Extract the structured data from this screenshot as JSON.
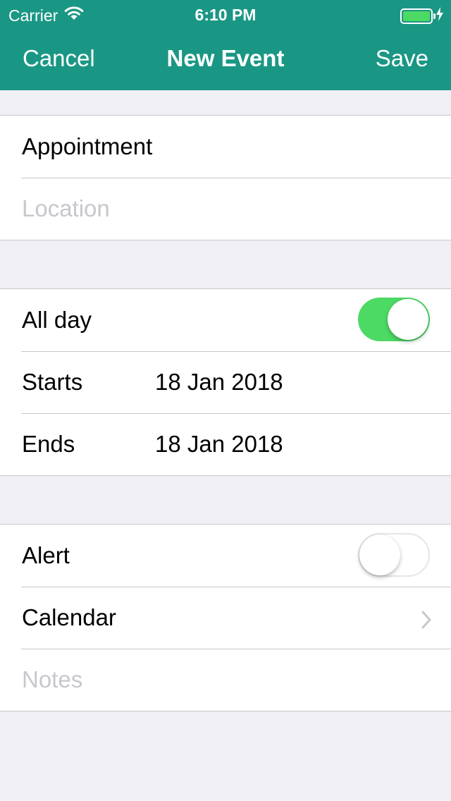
{
  "status_bar": {
    "carrier": "Carrier",
    "time": "6:10 PM",
    "battery_level": 1.0,
    "battery_color": "#4cd964",
    "charging": true
  },
  "nav": {
    "cancel_label": "Cancel",
    "title": "New Event",
    "save_label": "Save",
    "background_color": "#1a9784"
  },
  "event": {
    "title_value": "Appointment",
    "location_placeholder": "Location"
  },
  "schedule": {
    "all_day_label": "All day",
    "all_day_on": true,
    "starts_label": "Starts",
    "starts_value": "18 Jan 2018",
    "ends_label": "Ends",
    "ends_value": "18 Jan 2018"
  },
  "options": {
    "alert_label": "Alert",
    "alert_on": false,
    "calendar_label": "Calendar",
    "notes_placeholder": "Notes"
  },
  "icons": [
    "wifi-icon",
    "battery-icon",
    "charging-bolt-icon",
    "chevron-right-icon"
  ],
  "colors": {
    "accent": "#1a9784",
    "toggle_on": "#4cd964",
    "placeholder": "#c7c7cd"
  }
}
